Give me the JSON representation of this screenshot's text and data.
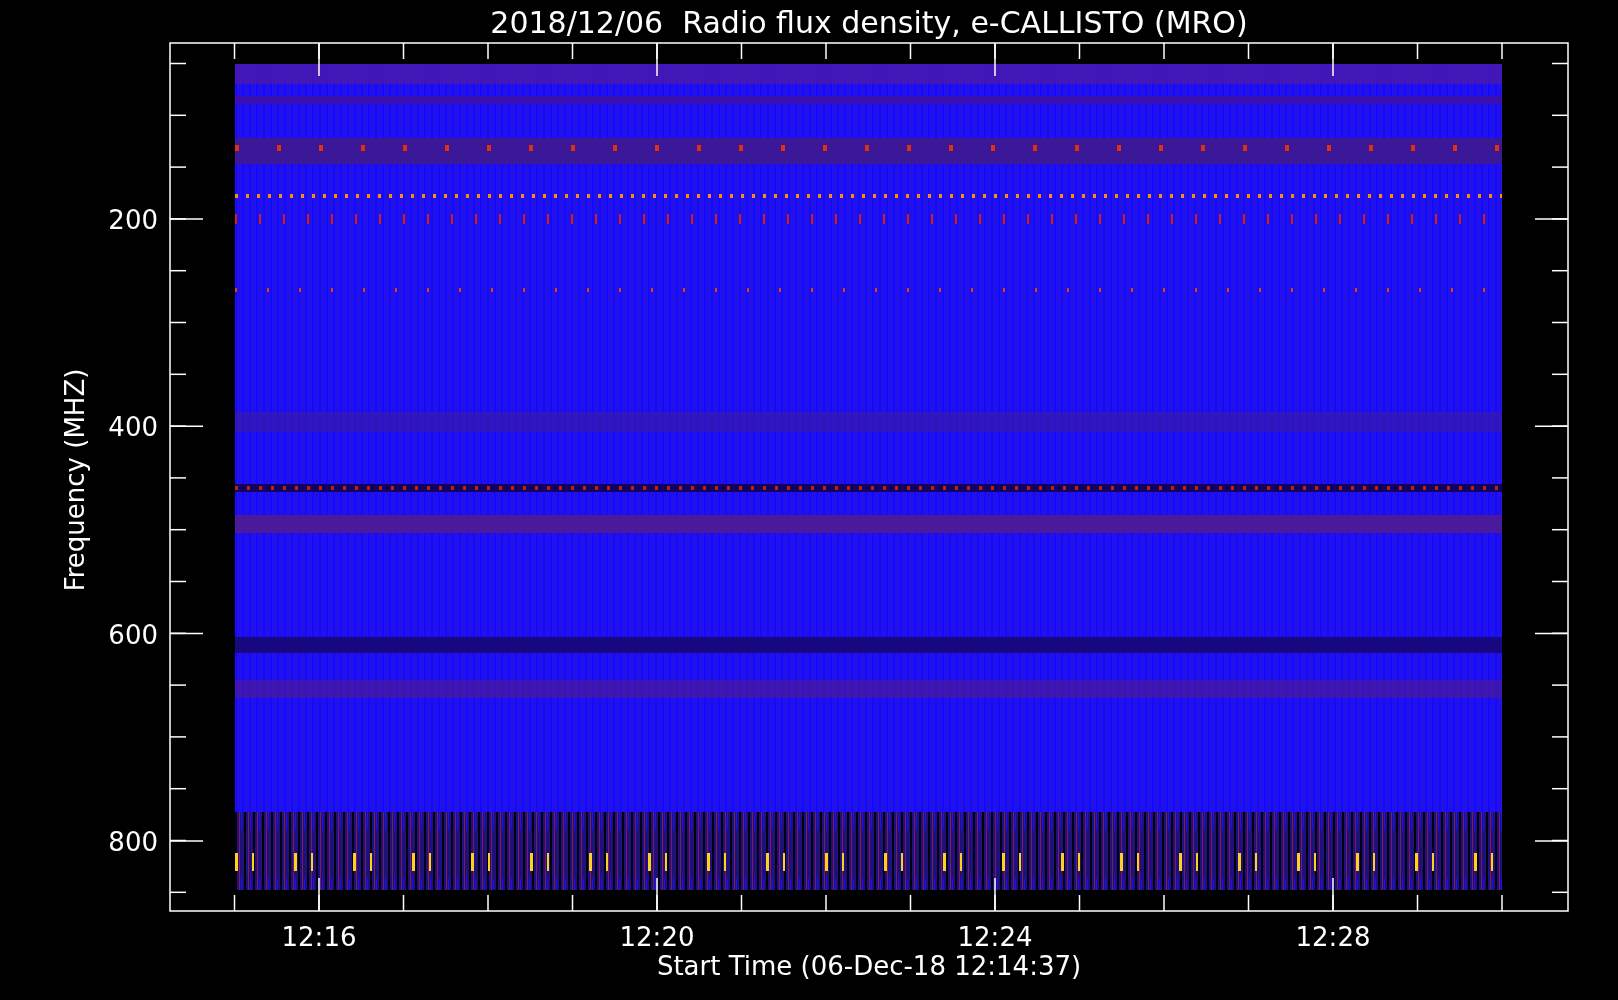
{
  "title": "2018/12/06  Radio flux density, e-CALLISTO (MRO)",
  "x_axis": {
    "label": "Start Time (06-Dec-18 12:14:37)",
    "ticks": [
      "12:16",
      "12:20",
      "12:24",
      "12:28"
    ]
  },
  "y_axis": {
    "label": "Frequency (MHZ)",
    "ticks": [
      "200",
      "400",
      "600",
      "800"
    ]
  }
}
